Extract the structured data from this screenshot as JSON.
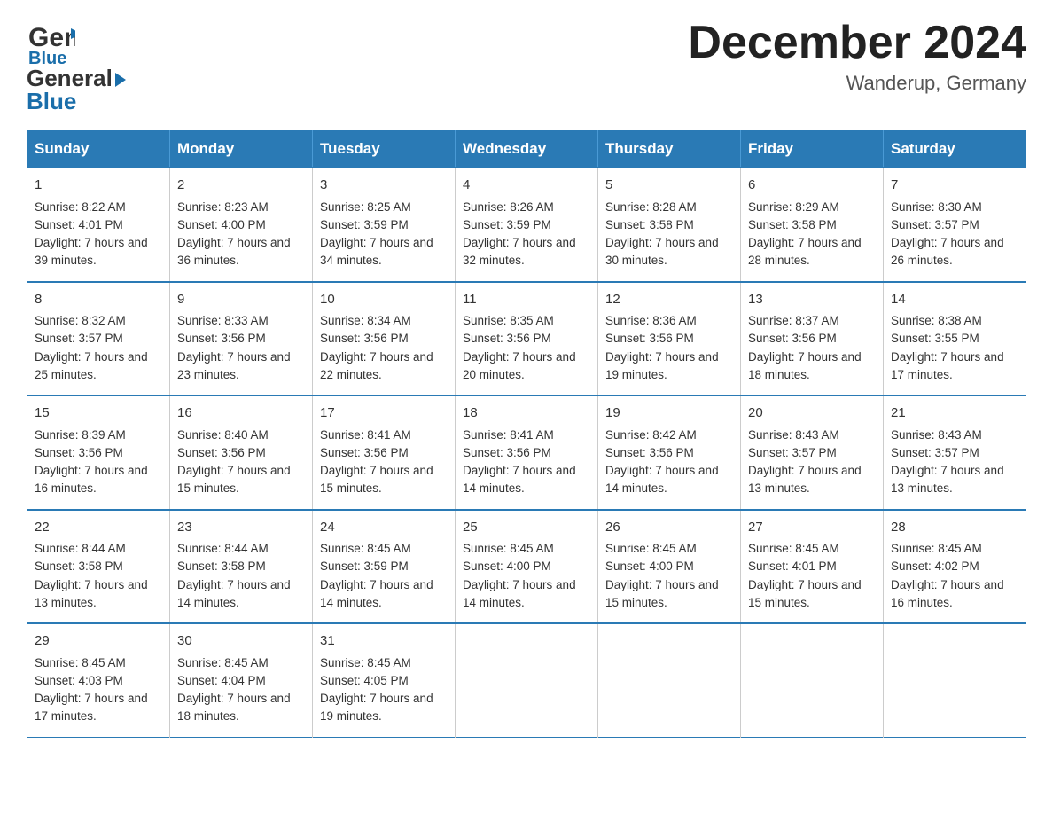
{
  "header": {
    "logo_general": "General",
    "logo_blue": "Blue",
    "month_title": "December 2024",
    "location": "Wanderup, Germany"
  },
  "days_of_week": [
    "Sunday",
    "Monday",
    "Tuesday",
    "Wednesday",
    "Thursday",
    "Friday",
    "Saturday"
  ],
  "weeks": [
    [
      {
        "day": "1",
        "sunrise": "8:22 AM",
        "sunset": "4:01 PM",
        "daylight": "7 hours and 39 minutes."
      },
      {
        "day": "2",
        "sunrise": "8:23 AM",
        "sunset": "4:00 PM",
        "daylight": "7 hours and 36 minutes."
      },
      {
        "day": "3",
        "sunrise": "8:25 AM",
        "sunset": "3:59 PM",
        "daylight": "7 hours and 34 minutes."
      },
      {
        "day": "4",
        "sunrise": "8:26 AM",
        "sunset": "3:59 PM",
        "daylight": "7 hours and 32 minutes."
      },
      {
        "day": "5",
        "sunrise": "8:28 AM",
        "sunset": "3:58 PM",
        "daylight": "7 hours and 30 minutes."
      },
      {
        "day": "6",
        "sunrise": "8:29 AM",
        "sunset": "3:58 PM",
        "daylight": "7 hours and 28 minutes."
      },
      {
        "day": "7",
        "sunrise": "8:30 AM",
        "sunset": "3:57 PM",
        "daylight": "7 hours and 26 minutes."
      }
    ],
    [
      {
        "day": "8",
        "sunrise": "8:32 AM",
        "sunset": "3:57 PM",
        "daylight": "7 hours and 25 minutes."
      },
      {
        "day": "9",
        "sunrise": "8:33 AM",
        "sunset": "3:56 PM",
        "daylight": "7 hours and 23 minutes."
      },
      {
        "day": "10",
        "sunrise": "8:34 AM",
        "sunset": "3:56 PM",
        "daylight": "7 hours and 22 minutes."
      },
      {
        "day": "11",
        "sunrise": "8:35 AM",
        "sunset": "3:56 PM",
        "daylight": "7 hours and 20 minutes."
      },
      {
        "day": "12",
        "sunrise": "8:36 AM",
        "sunset": "3:56 PM",
        "daylight": "7 hours and 19 minutes."
      },
      {
        "day": "13",
        "sunrise": "8:37 AM",
        "sunset": "3:56 PM",
        "daylight": "7 hours and 18 minutes."
      },
      {
        "day": "14",
        "sunrise": "8:38 AM",
        "sunset": "3:55 PM",
        "daylight": "7 hours and 17 minutes."
      }
    ],
    [
      {
        "day": "15",
        "sunrise": "8:39 AM",
        "sunset": "3:56 PM",
        "daylight": "7 hours and 16 minutes."
      },
      {
        "day": "16",
        "sunrise": "8:40 AM",
        "sunset": "3:56 PM",
        "daylight": "7 hours and 15 minutes."
      },
      {
        "day": "17",
        "sunrise": "8:41 AM",
        "sunset": "3:56 PM",
        "daylight": "7 hours and 15 minutes."
      },
      {
        "day": "18",
        "sunrise": "8:41 AM",
        "sunset": "3:56 PM",
        "daylight": "7 hours and 14 minutes."
      },
      {
        "day": "19",
        "sunrise": "8:42 AM",
        "sunset": "3:56 PM",
        "daylight": "7 hours and 14 minutes."
      },
      {
        "day": "20",
        "sunrise": "8:43 AM",
        "sunset": "3:57 PM",
        "daylight": "7 hours and 13 minutes."
      },
      {
        "day": "21",
        "sunrise": "8:43 AM",
        "sunset": "3:57 PM",
        "daylight": "7 hours and 13 minutes."
      }
    ],
    [
      {
        "day": "22",
        "sunrise": "8:44 AM",
        "sunset": "3:58 PM",
        "daylight": "7 hours and 13 minutes."
      },
      {
        "day": "23",
        "sunrise": "8:44 AM",
        "sunset": "3:58 PM",
        "daylight": "7 hours and 14 minutes."
      },
      {
        "day": "24",
        "sunrise": "8:45 AM",
        "sunset": "3:59 PM",
        "daylight": "7 hours and 14 minutes."
      },
      {
        "day": "25",
        "sunrise": "8:45 AM",
        "sunset": "4:00 PM",
        "daylight": "7 hours and 14 minutes."
      },
      {
        "day": "26",
        "sunrise": "8:45 AM",
        "sunset": "4:00 PM",
        "daylight": "7 hours and 15 minutes."
      },
      {
        "day": "27",
        "sunrise": "8:45 AM",
        "sunset": "4:01 PM",
        "daylight": "7 hours and 15 minutes."
      },
      {
        "day": "28",
        "sunrise": "8:45 AM",
        "sunset": "4:02 PM",
        "daylight": "7 hours and 16 minutes."
      }
    ],
    [
      {
        "day": "29",
        "sunrise": "8:45 AM",
        "sunset": "4:03 PM",
        "daylight": "7 hours and 17 minutes."
      },
      {
        "day": "30",
        "sunrise": "8:45 AM",
        "sunset": "4:04 PM",
        "daylight": "7 hours and 18 minutes."
      },
      {
        "day": "31",
        "sunrise": "8:45 AM",
        "sunset": "4:05 PM",
        "daylight": "7 hours and 19 minutes."
      },
      null,
      null,
      null,
      null
    ]
  ],
  "labels": {
    "sunrise": "Sunrise: ",
    "sunset": "Sunset: ",
    "daylight": "Daylight: "
  }
}
